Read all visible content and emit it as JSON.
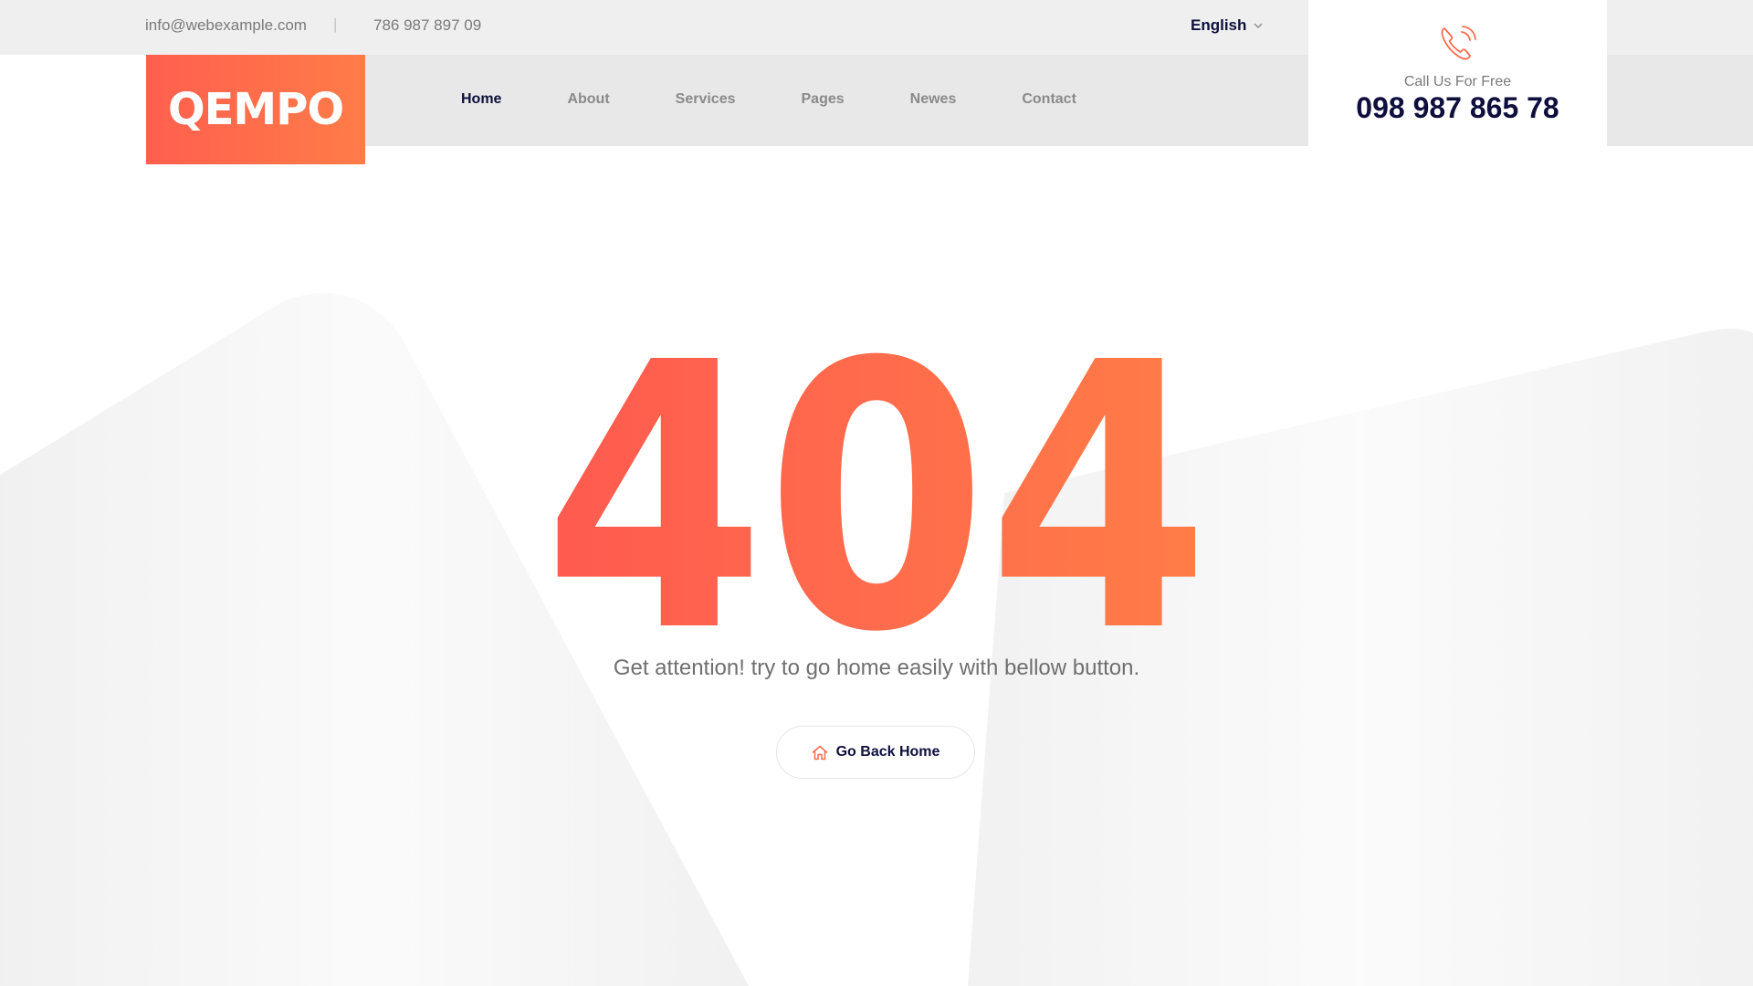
{
  "topbar": {
    "email": "info@webexample.com",
    "separator": "|",
    "phone": "786 987 897 09",
    "language": "English"
  },
  "logo": {
    "text": "QEMPO"
  },
  "nav": {
    "items": [
      {
        "label": "Home",
        "active": true
      },
      {
        "label": "About",
        "active": false
      },
      {
        "label": "Services",
        "active": false
      },
      {
        "label": "Pages",
        "active": false
      },
      {
        "label": "Newes",
        "active": false
      },
      {
        "label": "Contact",
        "active": false
      }
    ]
  },
  "call": {
    "icon": "phone-ringing-icon",
    "label": "Call Us For Free",
    "number": "098 987 865 78"
  },
  "error": {
    "code": "404",
    "message": "Get attention! try to go home easily with bellow button.",
    "button_label": "Go Back Home",
    "button_icon": "home-icon"
  },
  "colors": {
    "accent_start": "#ff5f4e",
    "accent_end": "#ff7c48",
    "dark": "#0f0f3d",
    "muted": "#7a7a7a",
    "topbar_bg": "#efefef",
    "navbar_bg": "#e8e8e8"
  }
}
